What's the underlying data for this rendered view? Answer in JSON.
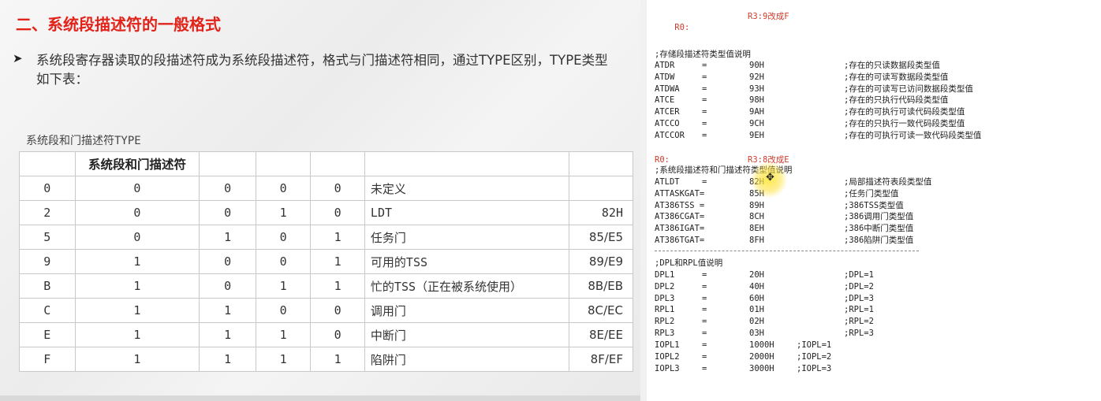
{
  "slide": {
    "title": "二、系统段描述符的一般格式",
    "bullet_marker": "➤",
    "bullet_text": "系统段寄存器读取的段描述符成为系统段描述符，格式与门描述符相同，通过TYPE区别，TYPE类型如下表：",
    "table_caption": "系统段和门描述符TYPE",
    "table_header": [
      "",
      "系统段和门描述符",
      "",
      "",
      "",
      "",
      ""
    ],
    "table_rows": [
      {
        "c0": "0",
        "c1": "0",
        "c2": "0",
        "c3": "0",
        "c4": "0",
        "desc": "未定义",
        "hex": ""
      },
      {
        "c0": "2",
        "c1": "0",
        "c2": "0",
        "c3": "1",
        "c4": "0",
        "desc": "LDT",
        "hex": "82H"
      },
      {
        "c0": "5",
        "c1": "0",
        "c2": "1",
        "c3": "0",
        "c4": "1",
        "desc": "任务门",
        "hex": "85/E5"
      },
      {
        "c0": "9",
        "c1": "1",
        "c2": "0",
        "c3": "0",
        "c4": "1",
        "desc": "可用的TSS",
        "hex": "89/E9"
      },
      {
        "c0": "B",
        "c1": "1",
        "c2": "0",
        "c3": "1",
        "c4": "1",
        "desc": "忙的TSS（正在被系统使用）",
        "hex": "8B/EB"
      },
      {
        "c0": "C",
        "c1": "1",
        "c2": "1",
        "c3": "0",
        "c4": "0",
        "desc": "调用门",
        "hex": "8C/EC"
      },
      {
        "c0": "E",
        "c1": "1",
        "c2": "1",
        "c3": "1",
        "c4": "0",
        "desc": "中断门",
        "hex": "8E/EE"
      },
      {
        "c0": "F",
        "c1": "1",
        "c2": "1",
        "c3": "1",
        "c4": "1",
        "desc": "陷阱门",
        "hex": "8F/EF"
      }
    ]
  },
  "code": {
    "note1": {
      "left": "R0:",
      "right": "R3:9改成F"
    },
    "section1_title": ";存储段描述符类型值说明",
    "section1": [
      {
        "name": "ATDR",
        "eq": "=",
        "val": "90H",
        "comment": ";存在的只读数据段类型值"
      },
      {
        "name": "ATDW",
        "eq": "=",
        "val": "92H",
        "comment": ";存在的可读写数据段类型值"
      },
      {
        "name": "ATDWA",
        "eq": "=",
        "val": "93H",
        "comment": ";存在的可读写已访问数据段类型值"
      },
      {
        "name": "ATCE",
        "eq": "=",
        "val": "98H",
        "comment": ";存在的只执行代码段类型值"
      },
      {
        "name": "ATCER",
        "eq": "=",
        "val": "9AH",
        "comment": ";存在的可执行可读代码段类型值"
      },
      {
        "name": "ATCCO",
        "eq": "=",
        "val": "9CH",
        "comment": ";存在的只执行一致代码段类型值"
      },
      {
        "name": "ATCCOR",
        "eq": "=",
        "val": "9EH",
        "comment": ";存在的可执行可读一致代码段类型值"
      }
    ],
    "note2": {
      "left": "R0:",
      "right": "R3:8改成E"
    },
    "section2_title": ";系统段描述符和门描述符类型值说明",
    "section2": [
      {
        "name": "ATLDT",
        "eq": "=",
        "val": "82H",
        "comment": ";局部描述符表段类型值"
      },
      {
        "name": "ATTASKGAT=",
        "eq": "",
        "val": "85H",
        "comment": ";任务门类型值"
      },
      {
        "name": "AT386TSS =",
        "eq": "",
        "val": "89H",
        "comment": ";386TSS类型值"
      },
      {
        "name": "AT386CGAT=",
        "eq": "",
        "val": "8CH",
        "comment": ";386调用门类型值"
      },
      {
        "name": "AT386IGAT=",
        "eq": "",
        "val": "8EH",
        "comment": ";386中断门类型值"
      },
      {
        "name": "AT386TGAT=",
        "eq": "",
        "val": "8FH",
        "comment": ";386陷阱门类型值"
      }
    ],
    "section3_title": ";DPL和RPL值说明",
    "section3": [
      {
        "name": "DPL1",
        "eq": "=",
        "val": "20H",
        "comment": ";DPL=1"
      },
      {
        "name": "DPL2",
        "eq": "=",
        "val": "40H",
        "comment": ";DPL=2"
      },
      {
        "name": "DPL3",
        "eq": "=",
        "val": "60H",
        "comment": ";DPL=3"
      },
      {
        "name": "RPL1",
        "eq": "=",
        "val": "01H",
        "comment": ";RPL=1"
      },
      {
        "name": "RPL2",
        "eq": "=",
        "val": "02H",
        "comment": ";RPL=2"
      },
      {
        "name": "RPL3",
        "eq": "=",
        "val": "03H",
        "comment": ";RPL=3"
      }
    ],
    "section4": [
      {
        "name": "IOPL1",
        "eq": "=",
        "val": "1000H",
        "comment": ";IOPL=1"
      },
      {
        "name": "IOPL2",
        "eq": "=",
        "val": "2000H",
        "comment": ";IOPL=2"
      },
      {
        "name": "IOPL3",
        "eq": "=",
        "val": "3000H",
        "comment": ";IOPL=3"
      }
    ]
  }
}
